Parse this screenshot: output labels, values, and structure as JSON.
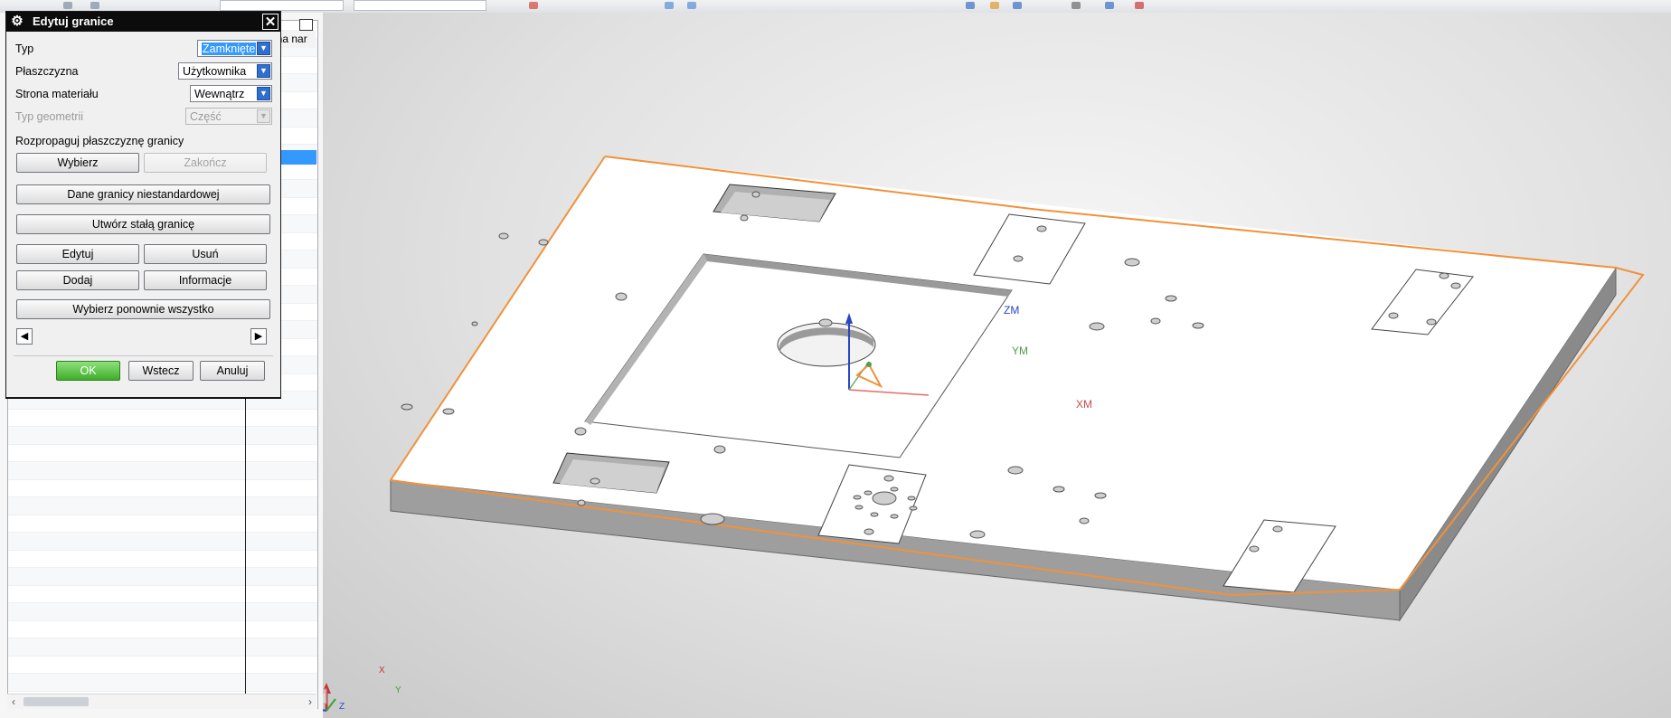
{
  "dialog": {
    "title": "Edytuj granice",
    "fields": {
      "type_label": "Typ",
      "type_value": "Zamknięte",
      "plane_label": "Płaszczyzna",
      "plane_value": "Użytkownika",
      "material_side_label": "Strona materiału",
      "material_side_value": "Wewnątrz",
      "geometry_type_label": "Typ geometrii",
      "geometry_type_value": "Część"
    },
    "propagate_label": "Rozpropaguj płaszczyznę granicy",
    "buttons": {
      "select": "Wybierz",
      "finish": "Zakończ",
      "custom_boundary_data": "Dane granicy niestandardowej",
      "create_permanent_boundary": "Utwórz stałą granicę",
      "edit": "Edytuj",
      "delete": "Usuń",
      "add": "Dodaj",
      "info": "Informacje",
      "reselect_all": "Wybierz ponownie wszystko",
      "ok": "OK",
      "back": "Wstecz",
      "cancel": "Anuluj"
    }
  },
  "navigator": {
    "column_header": "ana nar"
  },
  "viewport": {
    "wcs": {
      "z": "ZM",
      "y": "YM",
      "x": "XM"
    },
    "triad": {
      "x": "X",
      "y": "Y",
      "z": "Z"
    }
  },
  "colors": {
    "boundary": "#f0923a",
    "title_bar": "#0c0c0c",
    "selection": "#3399ff"
  }
}
